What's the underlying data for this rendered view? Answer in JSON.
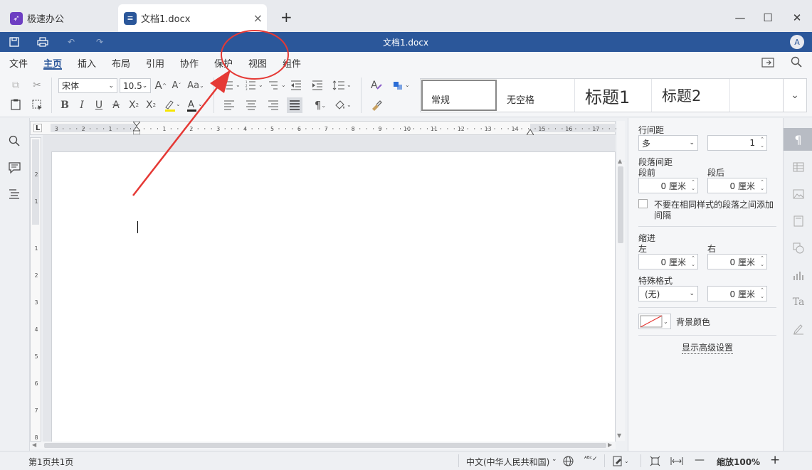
{
  "tabs": {
    "home": {
      "label": "极速办公",
      "icon": "rocket-icon",
      "color": "#6d3ec2"
    },
    "doc": {
      "label": "文档1.docx",
      "icon": "document-icon",
      "color": "#2b579a",
      "close": "×"
    },
    "add": "+"
  },
  "window": {
    "minimize": "—",
    "maximize": "☐",
    "close": "✕"
  },
  "titlebar": {
    "title": "文档1.docx",
    "avatar": "A",
    "bg": "#2b579a"
  },
  "menu": {
    "items": [
      "文件",
      "主页",
      "插入",
      "布局",
      "引用",
      "协作",
      "保护",
      "视图",
      "组件"
    ],
    "active": "主页"
  },
  "ribbon": {
    "font_name": "宋体",
    "font_size": "10.5",
    "styles": [
      "常规",
      "无空格",
      "标题1",
      "标题2"
    ]
  },
  "ruler": {
    "h_ticks": [
      "3",
      "2",
      "1",
      "1",
      "2",
      "3",
      "4",
      "5",
      "6",
      "7",
      "8",
      "9",
      "10",
      "11",
      "12",
      "13",
      "14",
      "15",
      "16",
      "17"
    ],
    "v_ticks": [
      "2",
      "1",
      "1",
      "2",
      "3",
      "4",
      "5",
      "6",
      "7",
      "8"
    ],
    "corner": "L"
  },
  "panel": {
    "line_spacing_label": "行间距",
    "line_spacing_type": "多",
    "line_spacing_value": "1",
    "para_spacing_label": "段落间距",
    "before_label": "段前",
    "after_label": "段后",
    "before_value": "0 厘米",
    "after_value": "0 厘米",
    "no_space_checkbox": "不要在相同样式的段落之间添加",
    "no_space_checkbox_2": "间隔",
    "indent_label": "缩进",
    "left_label": "左",
    "right_label": "右",
    "left_value": "0 厘米",
    "right_value": "0 厘米",
    "special_label": "特殊格式",
    "special_value": "(无)",
    "special_amount": "0 厘米",
    "bg_color_label": "背景颜色",
    "advanced_link": "显示高级设置"
  },
  "status": {
    "page_info": "第1页共1页",
    "language": "中文(中华人民共和国)",
    "zoom": "缩放100%",
    "minus": "—",
    "plus": "+"
  },
  "annotation": {
    "color": "#e53935"
  }
}
